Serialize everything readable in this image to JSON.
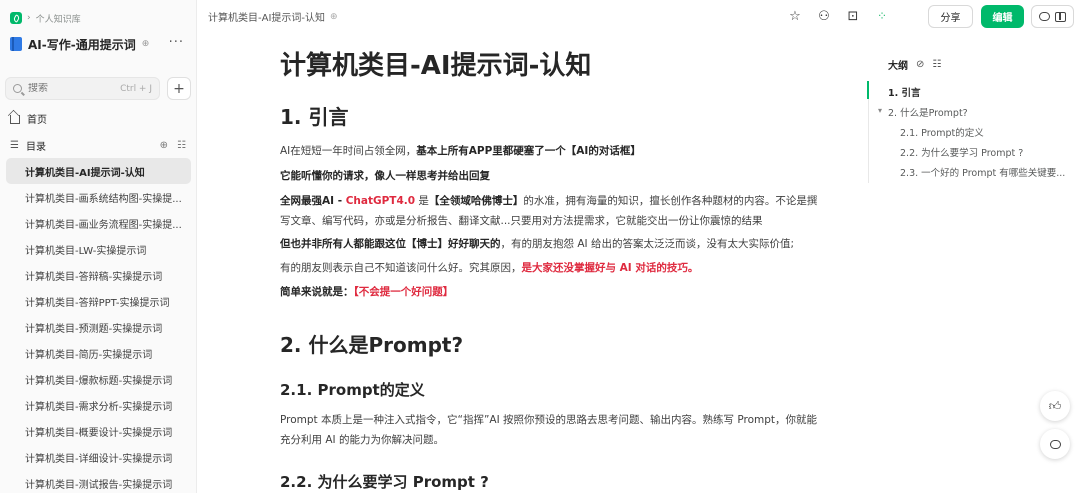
{
  "sidebar": {
    "crumb_label": "个人知识库",
    "kb_name": "AI-写作-通用提示词",
    "more_label": "···",
    "search_placeholder": "搜索",
    "search_shortcut": "Ctrl + J",
    "add_label": "+",
    "home_label": "首页",
    "toc_label": "目录",
    "docs": [
      "计算机类目-AI提示词-认知",
      "计算机类目-画系统结构图-实操提...",
      "计算机类目-画业务流程图-实操提...",
      "计算机类目-LW-实操提示词",
      "计算机类目-答辩稿-实操提示词",
      "计算机类目-答辩PPT-实操提示词",
      "计算机类目-预测题-实操提示词",
      "计算机类目-简历-实操提示词",
      "计算机类目-爆款标题-实操提示词",
      "计算机类目-需求分析-实操提示词",
      "计算机类目-概要设计-实操提示词",
      "计算机类目-详细设计-实操提示词",
      "计算机类目-测试报告-实操提示词"
    ]
  },
  "topbar": {
    "doc_crumb": "计算机类目-AI提示词-认知",
    "share_label": "分享",
    "edit_label": "编辑"
  },
  "doc": {
    "title": "计算机类目-AI提示词-认知",
    "s1_heading": "1. 引言",
    "p1_normal": "AI在短短一年时间占领全网，",
    "p1_bold": "基本上所有APP里都硬塞了一个【AI的对话框】",
    "p2_bold": "它能听懂你的请求，像人一样思考并给出回复",
    "p3_bold1": "全网最强AI - ",
    "p3_red": "ChatGPT4.0",
    "p3_normal1": " 是",
    "p3_bold2": "【全领域哈佛博士】",
    "p3_normal2": "的水准，拥有海量的知识，擅长创作各种题材的内容。不论是撰写文章、编写代码，亦或是分析报告、翻译文献...只要用对方法提需求，它就能交出一份让你震惊的结果",
    "p4_bold": "但也并非所有人都能跟这位【博士】好好聊天的",
    "p4_normal": "，有的朋友抱怨 AI 给出的答案太泛泛而谈，没有太大实际价值;",
    "p5_normal": "有的朋友则表示自己不知道该问什么好。究其原因，",
    "p5_red": "是大家还没掌握好与 AI 对话的技巧。",
    "p6_bold": "简单来说就是：",
    "p6_red": "【不会提一个好问题】",
    "s2_heading": "2. 什么是Prompt?",
    "s21_heading": "2.1. Prompt的定义",
    "p7_normal": "Prompt 本质上是一种注入式指令，它“指挥”AI 按照你预设的思路去思考问题、输出内容。熟练写 Prompt，你就能充分利用 AI 的能力为你解决问题。",
    "s22_heading": "2.2. 为什么要学习 Prompt ?"
  },
  "outline": {
    "title": "大纲",
    "items": [
      "1. 引言",
      "2. 什么是Prompt?",
      "2.1. Prompt的定义",
      "2.2. 为什么要学习 Prompt ?",
      "2.3. 一个好的 Prompt 有哪些关键要..."
    ]
  },
  "icons": {
    "accent_color": "#00b96b",
    "highlight_color": "#df2a3f",
    "top_icons": [
      "star-icon",
      "add-member-icon",
      "present-icon",
      "apps-icon"
    ]
  }
}
